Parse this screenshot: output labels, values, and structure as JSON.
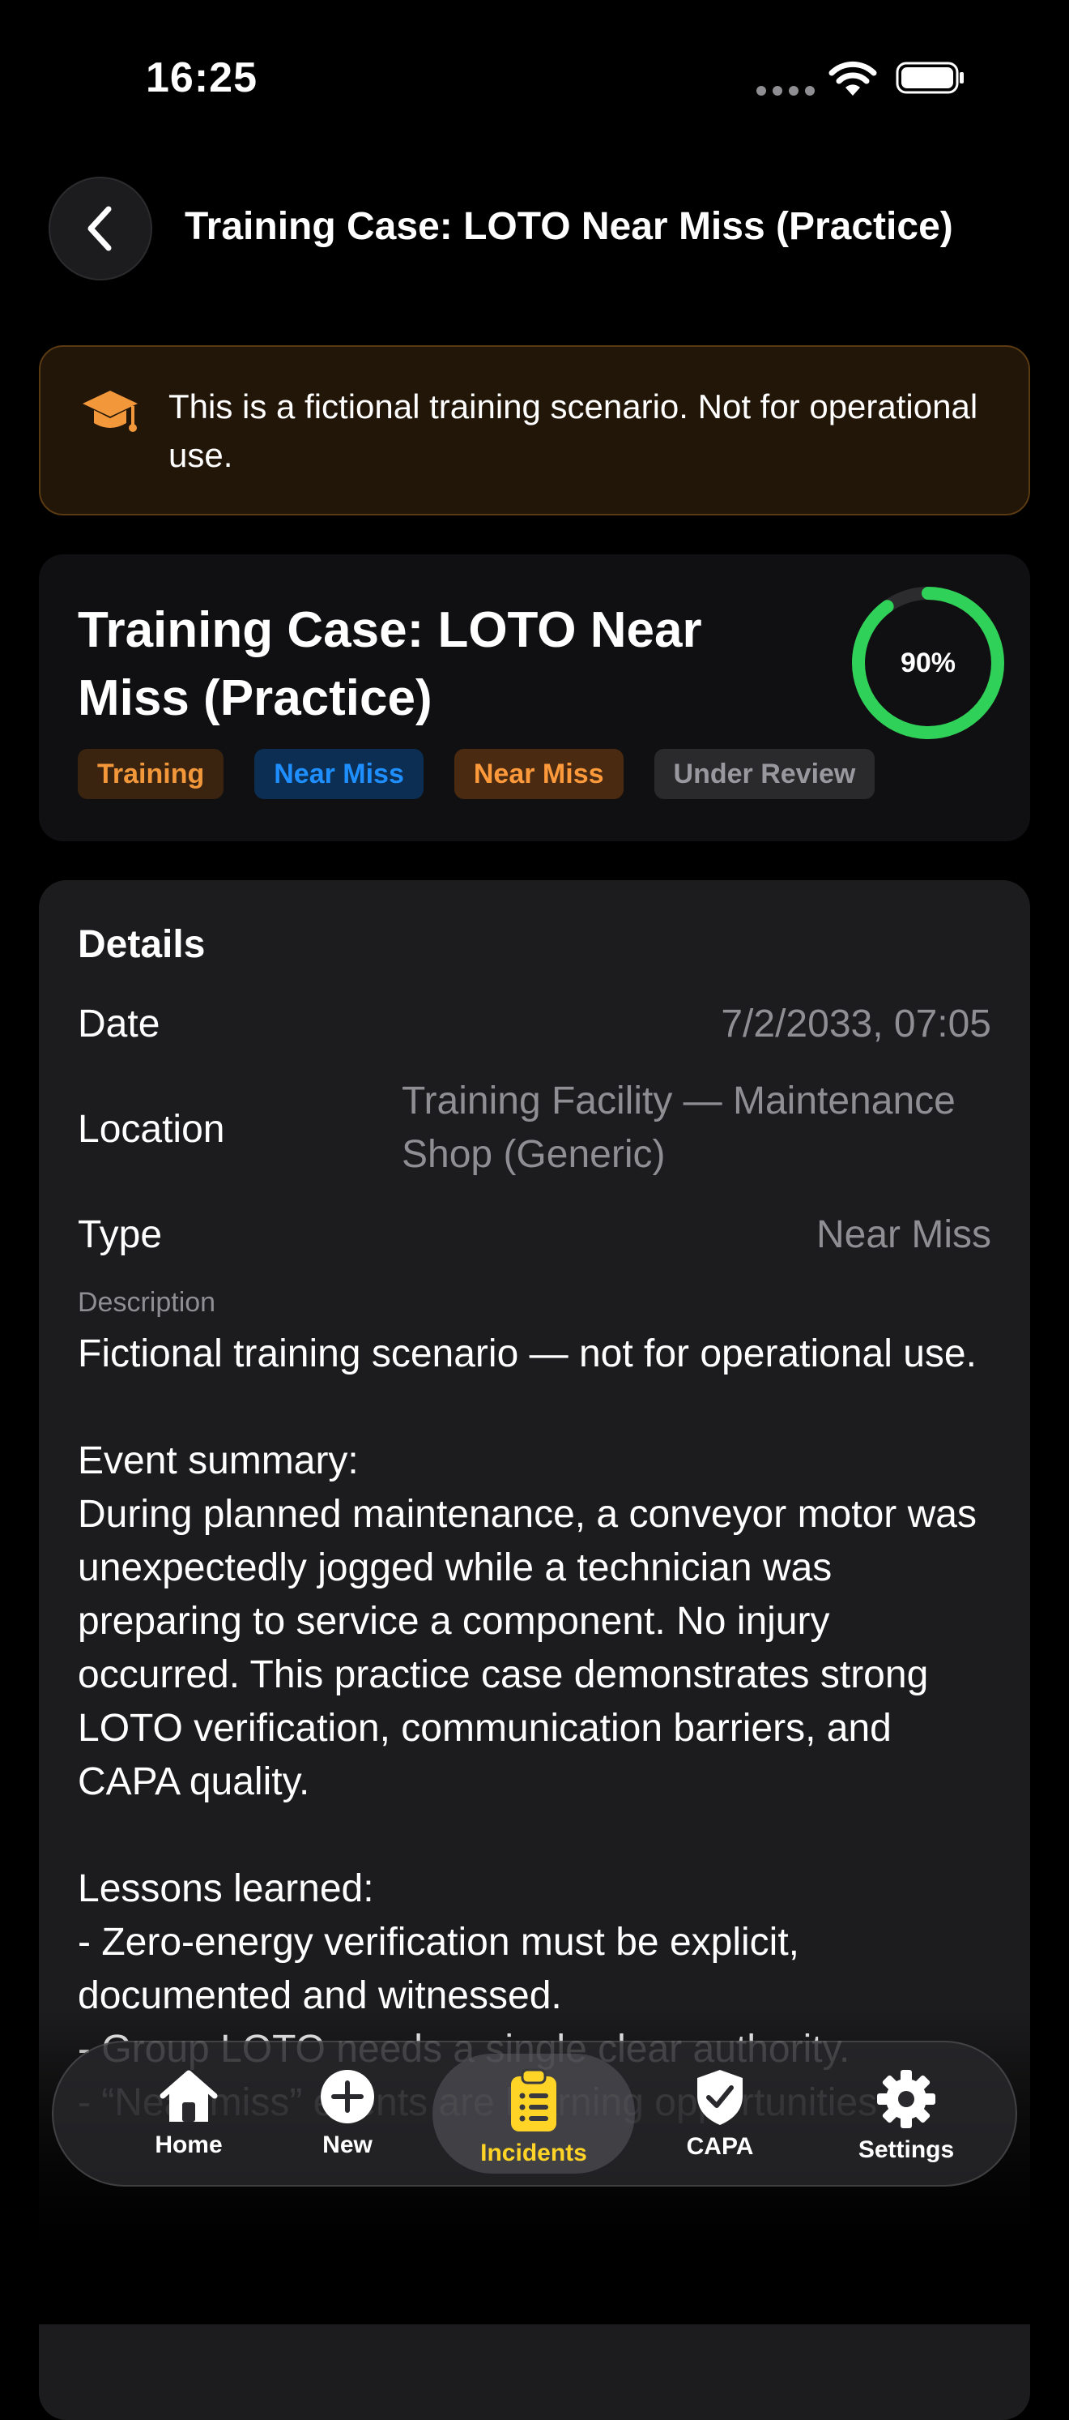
{
  "status_bar": {
    "time": "16:25"
  },
  "nav": {
    "title": "Training Case: LOTO Near Miss (Practice)"
  },
  "banner": {
    "text": "This is a fictional training scenario. Not for operational use."
  },
  "case": {
    "title": "Training Case: LOTO Near Miss (Practice)",
    "progress": "90%",
    "progress_fraction": 0.9,
    "tags": [
      "Training",
      "Near Miss",
      "Near Miss",
      "Under Review"
    ]
  },
  "details": {
    "heading": "Details",
    "date_label": "Date",
    "date_value": "7/2/2033, 07:05",
    "location_label": "Location",
    "location_value": "Training Facility — Maintenance Shop (Generic)",
    "type_label": "Type",
    "type_value": "Near Miss",
    "description_label": "Description",
    "description": "Fictional training scenario — not for operational use.\n\nEvent summary:\nDuring planned maintenance, a conveyor motor was unexpectedly jogged while a technician was preparing to service a component. No injury occurred. This practice case demonstrates strong LOTO verification, communication barriers, and CAPA quality.\n\nLessons learned:\n- Zero-energy verification must be explicit, documented and witnessed.\n- Group LOTO needs a single clear authority.\n- “Near miss” events are learning opportunities"
  },
  "tab_bar": {
    "home": "Home",
    "new": "New",
    "incidents": "Incidents",
    "capa": "CAPA",
    "settings": "Settings"
  },
  "colors": {
    "accent": "#ffd426",
    "progress": "#30d158",
    "training": "#f2973a",
    "near_miss_blue": "#1f8fff",
    "near_miss_orange": "#ff9a3c"
  }
}
